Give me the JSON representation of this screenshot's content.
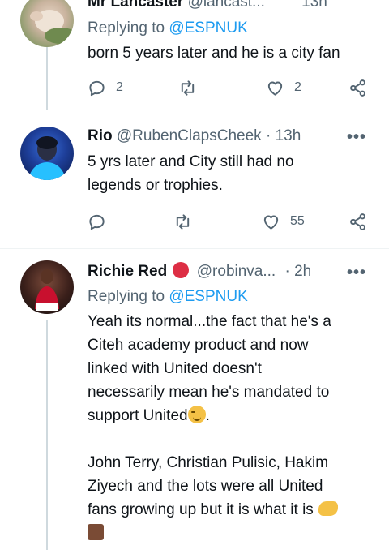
{
  "tweets": [
    {
      "name": "Mr Lancaster",
      "handle": "@lancast...",
      "time": "13h",
      "reply_label": "Replying to",
      "reply_handle": "@ESPNUK",
      "text": "born 5 years later and he is a city fan",
      "replies": "2",
      "retweets": "",
      "likes": "2"
    },
    {
      "name": "Rio",
      "handle": "@RubenClapsCheek",
      "dot": "·",
      "time": "13h",
      "text": "5 yrs later and City still had no\nlegends or trophies.",
      "replies": "",
      "retweets": "",
      "likes": "55"
    },
    {
      "name": "Richie Red",
      "handle": "@robinva...",
      "dot": "·",
      "time": "2h",
      "reply_label": "Replying to",
      "reply_handle": "@ESPNUK",
      "text_p1": "Yeah its normal...the fact that he's a\nCiteh academy product and now\nlinked with United doesn't\nnecessarily mean he's mandated to\nsupport United",
      "text_p1_end": ".",
      "text_p2": "John Terry, Christian Pulisic, Hakim\nZiyech and the lots were all United\nfans growing up but it is what it is"
    }
  ],
  "more_label": "•••",
  "icons": {
    "reply": "reply-icon",
    "retweet": "retweet-icon",
    "like": "heart-icon",
    "share": "share-icon"
  },
  "colors": {
    "link": "#1d9bf0",
    "secondary": "#536471",
    "thread_line": "#cfd9de"
  }
}
